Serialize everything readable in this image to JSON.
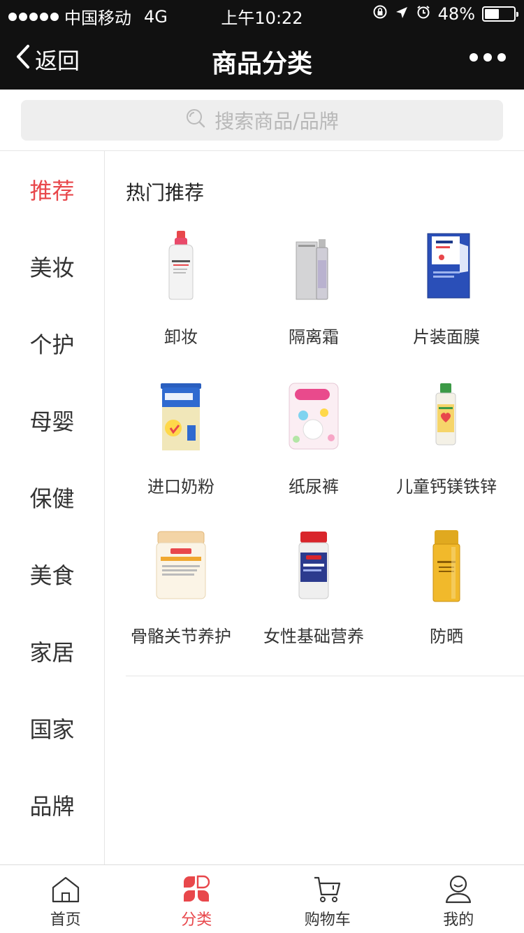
{
  "status_bar": {
    "carrier": "中国移动",
    "network": "4G",
    "time": "上午10:22",
    "battery": "48%",
    "battery_level": 0.48
  },
  "nav": {
    "back_label": "返回",
    "title": "商品分类"
  },
  "search": {
    "placeholder": "搜索商品/品牌"
  },
  "sidebar": {
    "items": [
      {
        "label": "推荐",
        "active": true
      },
      {
        "label": "美妆"
      },
      {
        "label": "个护"
      },
      {
        "label": "母婴"
      },
      {
        "label": "保健"
      },
      {
        "label": "美食"
      },
      {
        "label": "家居"
      },
      {
        "label": "国家"
      },
      {
        "label": "品牌"
      }
    ]
  },
  "main": {
    "section_title": "热门推荐",
    "products": [
      {
        "label": "卸妆",
        "icon": "micellar-water-bottle-icon"
      },
      {
        "label": "隔离霜",
        "icon": "serum-bottle-icon"
      },
      {
        "label": "片装面膜",
        "icon": "sheet-mask-icon"
      },
      {
        "label": "进口奶粉",
        "icon": "milk-powder-can-icon"
      },
      {
        "label": "纸尿裤",
        "icon": "diaper-pack-icon"
      },
      {
        "label": "儿童钙镁铁锌",
        "icon": "kids-supplement-bottle-icon"
      },
      {
        "label": "骨骼关节养护",
        "icon": "calcium-jar-icon"
      },
      {
        "label": "女性基础营养",
        "icon": "vitamin-bottle-icon"
      },
      {
        "label": "防晒",
        "icon": "sunscreen-bottle-icon"
      }
    ]
  },
  "tabbar": {
    "tabs": [
      {
        "label": "首页",
        "icon": "home-icon"
      },
      {
        "label": "分类",
        "icon": "category-icon",
        "active": true
      },
      {
        "label": "购物车",
        "icon": "cart-icon"
      },
      {
        "label": "我的",
        "icon": "profile-icon"
      }
    ]
  },
  "colors": {
    "accent": "#e8474b",
    "header_bg": "#111111",
    "search_bg": "#eeeeee"
  }
}
